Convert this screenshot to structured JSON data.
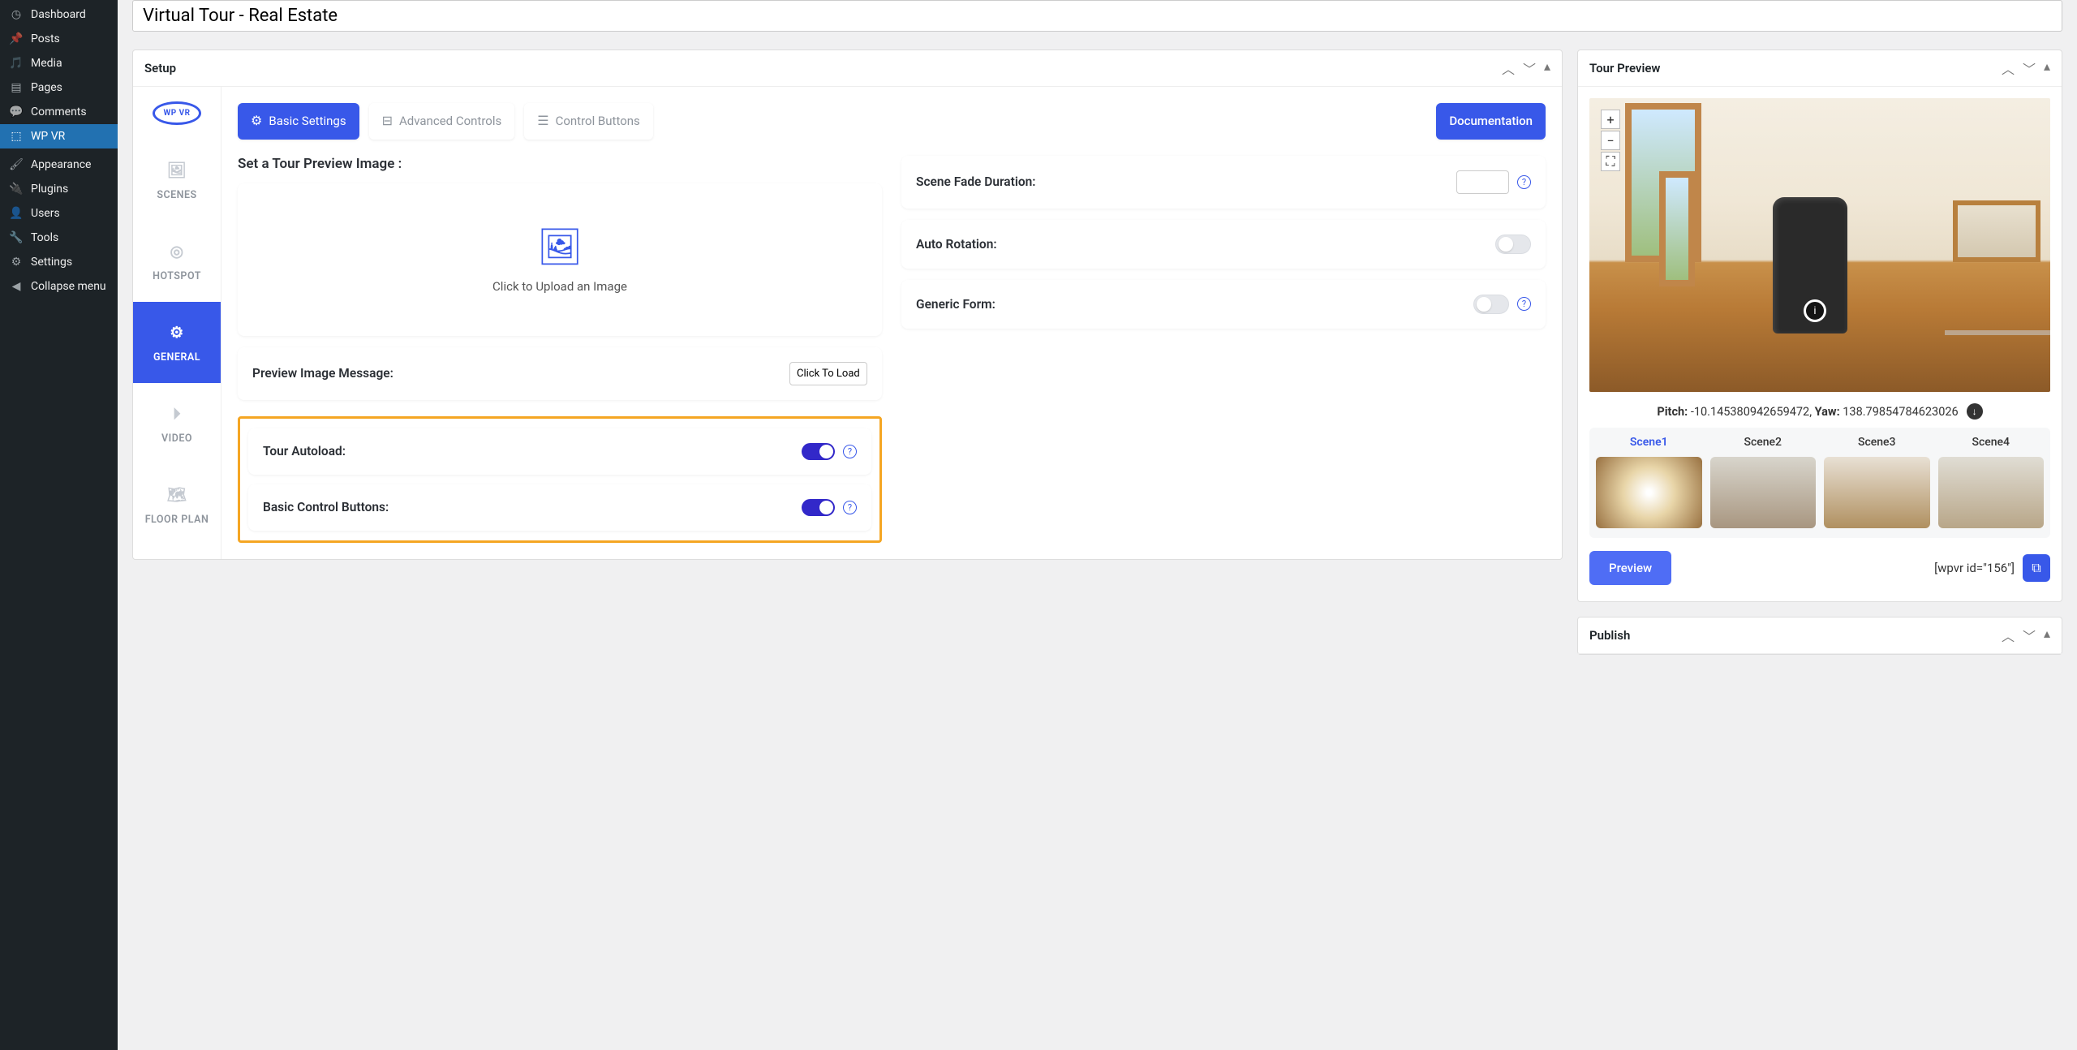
{
  "sidebar": {
    "items": [
      {
        "label": "Dashboard",
        "icon": "gauge"
      },
      {
        "label": "Posts",
        "icon": "pin"
      },
      {
        "label": "Media",
        "icon": "media"
      },
      {
        "label": "Pages",
        "icon": "pages"
      },
      {
        "label": "Comments",
        "icon": "comment"
      },
      {
        "label": "WP VR",
        "icon": "vr",
        "active": true
      },
      {
        "label": "Appearance",
        "icon": "brush"
      },
      {
        "label": "Plugins",
        "icon": "plug"
      },
      {
        "label": "Users",
        "icon": "user"
      },
      {
        "label": "Tools",
        "icon": "wrench"
      },
      {
        "label": "Settings",
        "icon": "sliders"
      },
      {
        "label": "Collapse menu",
        "icon": "collapse"
      }
    ]
  },
  "title": "Virtual Tour - Real Estate",
  "setup": {
    "panel_title": "Setup",
    "logo": "WP VR",
    "vtabs": [
      {
        "label": "SCENES",
        "icon": "image"
      },
      {
        "label": "HOTSPOT",
        "icon": "target"
      },
      {
        "label": "GENERAL",
        "icon": "gear",
        "active": true
      },
      {
        "label": "VIDEO",
        "icon": "video"
      },
      {
        "label": "FLOOR PLAN",
        "icon": "map"
      }
    ],
    "htabs": [
      {
        "label": "Basic Settings",
        "icon": "gear",
        "active": true
      },
      {
        "label": "Advanced Controls",
        "icon": "switches"
      },
      {
        "label": "Control Buttons",
        "icon": "sliders"
      }
    ],
    "doc_label": "Documentation",
    "fields": {
      "preview_image_heading": "Set a Tour Preview Image :",
      "upload_text": "Click to Upload an Image",
      "preview_msg_label": "Preview Image Message:",
      "preview_msg_value": "Click To Load",
      "tour_autoload_label": "Tour Autoload:",
      "tour_autoload_on": true,
      "basic_ctrl_label": "Basic Control Buttons:",
      "basic_ctrl_on": true,
      "scene_fade_label": "Scene Fade Duration:",
      "scene_fade_value": "",
      "auto_rotation_label": "Auto Rotation:",
      "auto_rotation_on": false,
      "generic_form_label": "Generic Form:",
      "generic_form_on": false
    }
  },
  "preview": {
    "panel_title": "Tour Preview",
    "pitch_label": "Pitch:",
    "pitch_value": "-10.145380942659472",
    "yaw_label": "Yaw:",
    "yaw_value": "138.79854784623026",
    "scenes": [
      "Scene1",
      "Scene2",
      "Scene3",
      "Scene4"
    ],
    "active_scene": 0,
    "preview_btn": "Preview",
    "shortcode": "[wpvr id=\"156\"]"
  },
  "publish": {
    "panel_title": "Publish"
  }
}
